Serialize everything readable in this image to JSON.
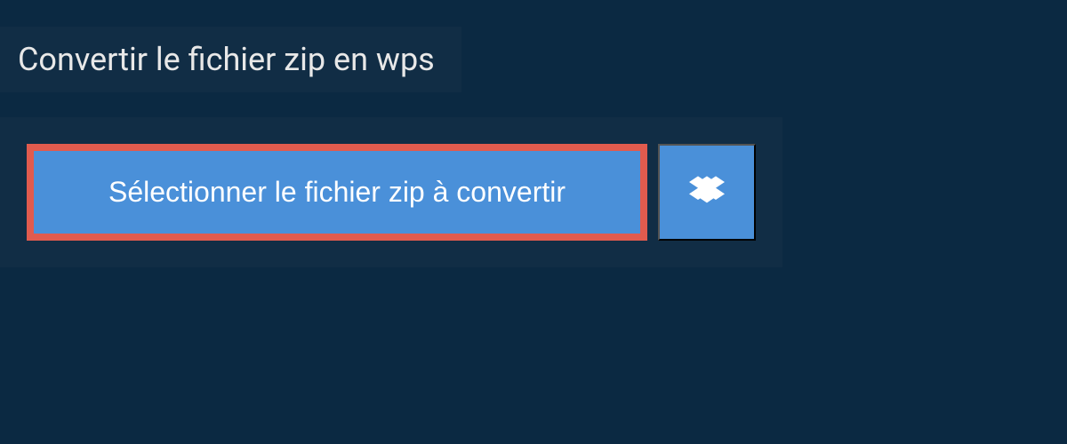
{
  "header": {
    "title": "Convertir le fichier zip en wps"
  },
  "main": {
    "select_button_label": "Sélectionner le fichier zip à convertir"
  },
  "colors": {
    "background": "#0b2942",
    "panel": "#112d45",
    "button": "#4a90d9",
    "highlight_border": "#e15b4e"
  }
}
